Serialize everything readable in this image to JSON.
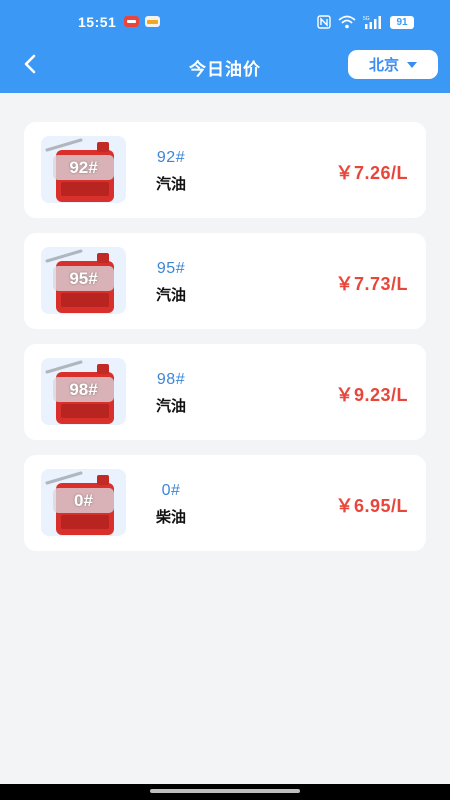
{
  "status_bar": {
    "time": "15:51",
    "battery": "91",
    "icons": [
      "nfc-icon",
      "wifi-icon",
      "signal-5g-icon",
      "battery-icon"
    ]
  },
  "header": {
    "title": "今日油价",
    "city": "北京",
    "background_color": "#3b99f5"
  },
  "fuel_list": [
    {
      "grade": "92#",
      "code": "92#",
      "type": "汽油",
      "price": "￥7.26/L"
    },
    {
      "grade": "95#",
      "code": "95#",
      "type": "汽油",
      "price": "￥7.73/L"
    },
    {
      "grade": "98#",
      "code": "98#",
      "type": "汽油",
      "price": "￥9.23/L"
    },
    {
      "grade": "0#",
      "code": "0#",
      "type": "柴油",
      "price": "￥6.95/L"
    }
  ],
  "colors": {
    "price": "#e8463a",
    "code": "#3d86d6",
    "can_body": "#d9302c"
  }
}
